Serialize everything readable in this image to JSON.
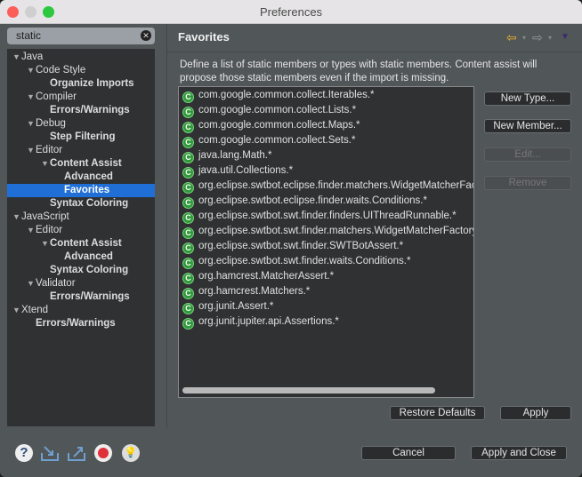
{
  "window": {
    "title": "Preferences"
  },
  "search": {
    "value": "static"
  },
  "tree": [
    {
      "label": "Java",
      "level": 0,
      "arrow": true,
      "bold": false
    },
    {
      "label": "Code Style",
      "level": 1,
      "arrow": true,
      "bold": false
    },
    {
      "label": "Organize Imports",
      "level": 2,
      "arrow": false,
      "bold": true
    },
    {
      "label": "Compiler",
      "level": 1,
      "arrow": true,
      "bold": false
    },
    {
      "label": "Errors/Warnings",
      "level": 2,
      "arrow": false,
      "bold": true
    },
    {
      "label": "Debug",
      "level": 1,
      "arrow": true,
      "bold": false
    },
    {
      "label": "Step Filtering",
      "level": 2,
      "arrow": false,
      "bold": true
    },
    {
      "label": "Editor",
      "level": 1,
      "arrow": true,
      "bold": false
    },
    {
      "label": "Content Assist",
      "level": 2,
      "arrow": true,
      "bold": true
    },
    {
      "label": "Advanced",
      "level": 3,
      "arrow": false,
      "bold": true
    },
    {
      "label": "Favorites",
      "level": 3,
      "arrow": false,
      "bold": true,
      "selected": true
    },
    {
      "label": "Syntax Coloring",
      "level": 2,
      "arrow": false,
      "bold": true
    },
    {
      "label": "JavaScript",
      "level": 0,
      "arrow": true,
      "bold": false
    },
    {
      "label": "Editor",
      "level": 1,
      "arrow": true,
      "bold": false
    },
    {
      "label": "Content Assist",
      "level": 2,
      "arrow": true,
      "bold": true
    },
    {
      "label": "Advanced",
      "level": 3,
      "arrow": false,
      "bold": true
    },
    {
      "label": "Syntax Coloring",
      "level": 2,
      "arrow": false,
      "bold": true
    },
    {
      "label": "Validator",
      "level": 1,
      "arrow": true,
      "bold": false
    },
    {
      "label": "Errors/Warnings",
      "level": 2,
      "arrow": false,
      "bold": true
    },
    {
      "label": "Xtend",
      "level": 0,
      "arrow": true,
      "bold": false
    },
    {
      "label": "Errors/Warnings",
      "level": 1,
      "arrow": false,
      "bold": true
    }
  ],
  "page": {
    "title": "Favorites",
    "description": "Define a list of static members or types with static members. Content assist will propose those static members even if the import is missing.",
    "favorites": [
      "com.google.common.collect.Iterables.*",
      "com.google.common.collect.Lists.*",
      "com.google.common.collect.Maps.*",
      "com.google.common.collect.Sets.*",
      "java.lang.Math.*",
      "java.util.Collections.*",
      "org.eclipse.swtbot.eclipse.finder.matchers.WidgetMatcherFactory.*",
      "org.eclipse.swtbot.eclipse.finder.waits.Conditions.*",
      "org.eclipse.swtbot.swt.finder.finders.UIThreadRunnable.*",
      "org.eclipse.swtbot.swt.finder.matchers.WidgetMatcherFactory.*",
      "org.eclipse.swtbot.swt.finder.SWTBotAssert.*",
      "org.eclipse.swtbot.swt.finder.waits.Conditions.*",
      "org.hamcrest.MatcherAssert.*",
      "org.hamcrest.Matchers.*",
      "org.junit.Assert.*",
      "org.junit.jupiter.api.Assertions.*"
    ],
    "buttons": {
      "new_type": "New Type...",
      "new_member": "New Member...",
      "edit": "Edit...",
      "remove": "Remove",
      "restore": "Restore Defaults",
      "apply": "Apply"
    }
  },
  "footer": {
    "cancel": "Cancel",
    "apply_close": "Apply and Close"
  }
}
